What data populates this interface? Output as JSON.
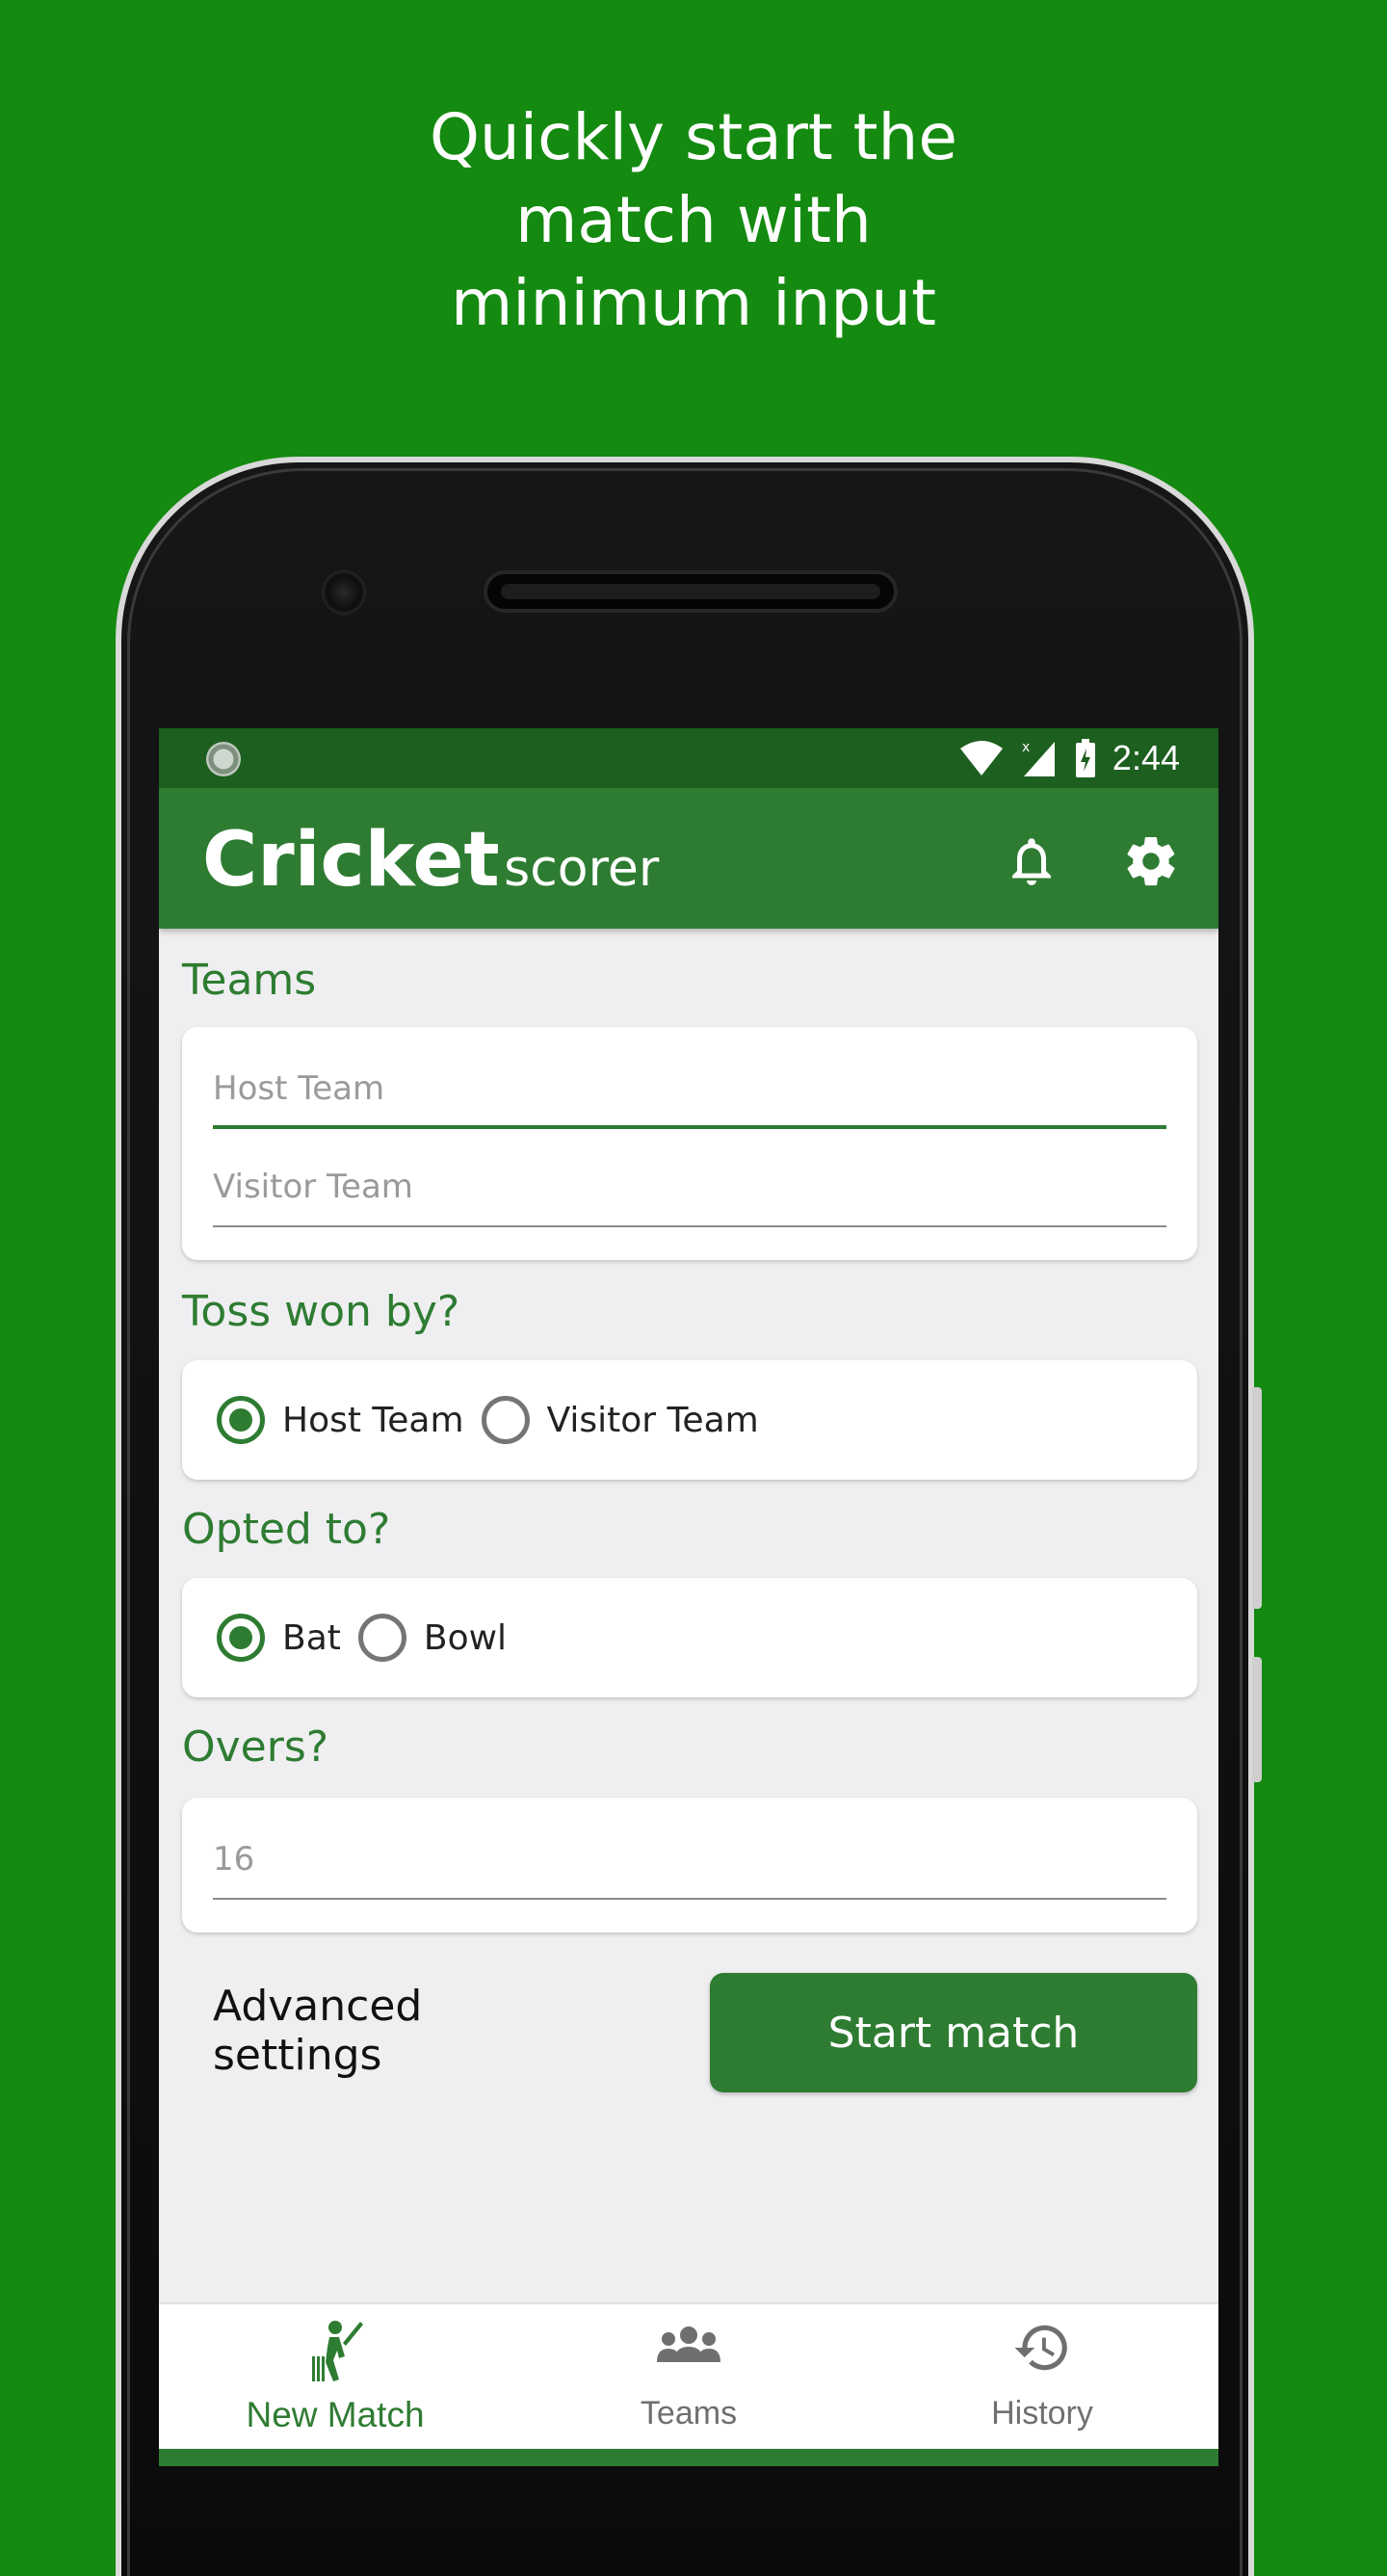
{
  "promo": {
    "line1": "Quickly start the",
    "line2": "match with",
    "line3": "minimum input"
  },
  "status_bar": {
    "time": "2:44"
  },
  "app_bar": {
    "title_main": "Cricket",
    "title_sub": "scorer",
    "icons": [
      "bell-icon",
      "gear-icon"
    ]
  },
  "teams": {
    "label": "Teams",
    "host_placeholder": "Host Team",
    "visitor_placeholder": "Visitor Team"
  },
  "toss": {
    "label": "Toss won by?",
    "options": [
      "Host Team",
      "Visitor Team"
    ],
    "selected": "Host Team"
  },
  "opted": {
    "label": "Opted to?",
    "options": [
      "Bat",
      "Bowl"
    ],
    "selected": "Bat"
  },
  "overs": {
    "label": "Overs?",
    "placeholder": "16"
  },
  "actions": {
    "advanced": "Advanced settings",
    "start": "Start match"
  },
  "bottom_nav": {
    "items": [
      {
        "label": "New Match",
        "icon": "cricket-batsman-icon",
        "active": true
      },
      {
        "label": "Teams",
        "icon": "group-icon",
        "active": false
      },
      {
        "label": "History",
        "icon": "history-icon",
        "active": false
      }
    ]
  },
  "colors": {
    "background": "#148a10",
    "primary": "#2e7c32",
    "status_bar": "#1d5f1f"
  }
}
